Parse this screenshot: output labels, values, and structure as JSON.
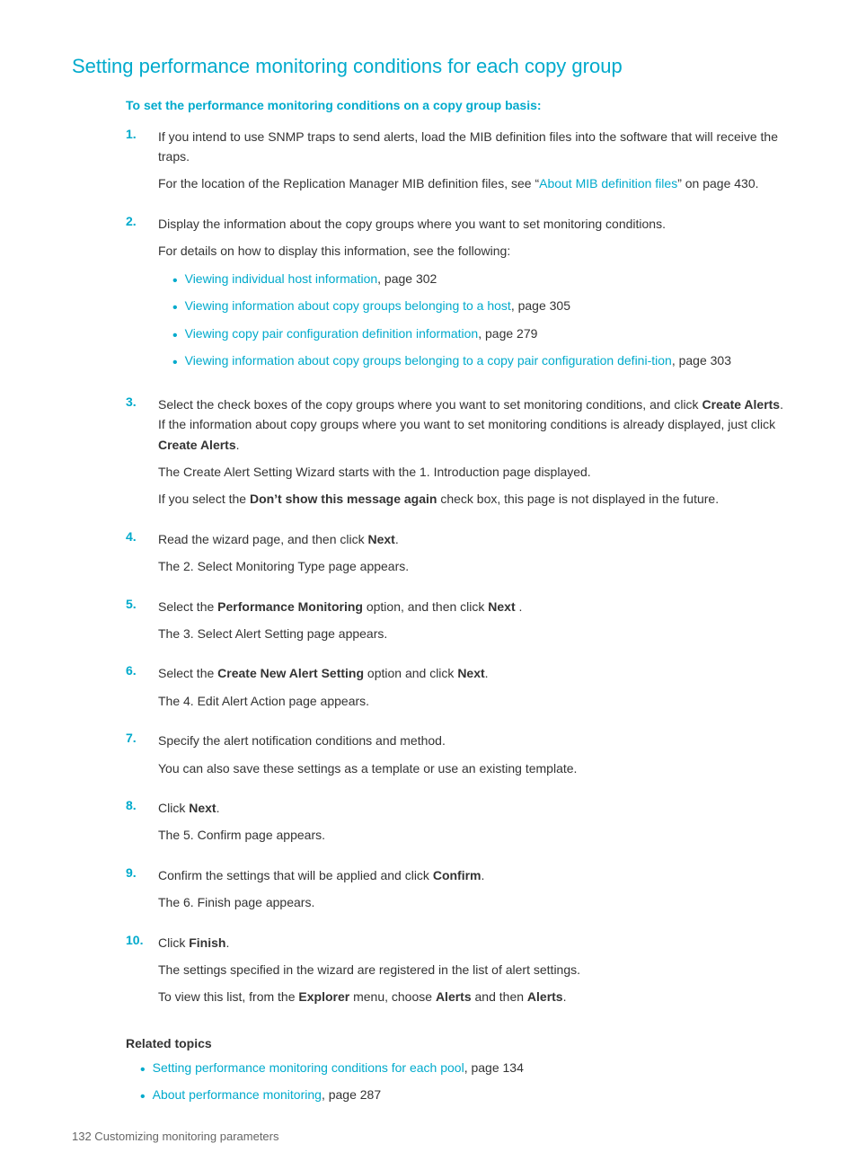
{
  "page": {
    "title": "Setting performance monitoring conditions for each copy group",
    "subtitle": "To set the performance monitoring conditions on a copy group basis:",
    "steps": [
      {
        "number": "1.",
        "text": "If you intend to use SNMP traps to send alerts,  load the MIB definition files into the software that will receive the traps.",
        "sub": "For the location of the Replication Manager MIB definition files, see “",
        "link1": "About MIB definition files",
        "link1_after": "” on page 430.",
        "has_sub": true
      },
      {
        "number": "2.",
        "text": "Display the information about the copy groups where you want to set monitoring conditions.",
        "sub": "For details on how to display this information, see the following:",
        "has_bullets": true
      },
      {
        "number": "3.",
        "text_parts": [
          "Select the check boxes of the copy groups where you want to set monitoring conditions, and click ",
          "Create Alerts",
          ". If the information about copy groups where you want to set monitoring conditions is already displayed, just click ",
          "Create Alerts",
          "."
        ],
        "sub1": "The Create Alert Setting Wizard starts with the 1. Introduction page displayed.",
        "sub2_parts": [
          "If you select the ",
          "Don’t show this message again",
          " check box, this page is not displayed in the future."
        ],
        "has_sub2": true
      },
      {
        "number": "4.",
        "text_parts": [
          "Read the wizard page, and then click ",
          "Next",
          "."
        ],
        "sub": "The 2. Select Monitoring Type page appears."
      },
      {
        "number": "5.",
        "text_parts": [
          "Select the ",
          "Performance Monitoring",
          " option, and then click ",
          "Next",
          " ."
        ],
        "sub": "The 3. Select Alert Setting page appears."
      },
      {
        "number": "6.",
        "text_parts": [
          "Select the ",
          "Create New Alert Setting",
          " option and click ",
          "Next",
          "."
        ],
        "sub": "The 4. Edit Alert Action page appears."
      },
      {
        "number": "7.",
        "text": "Specify the alert notification conditions and method.",
        "sub": "You can also save these settings as a template or use an existing template."
      },
      {
        "number": "8.",
        "text_parts": [
          "Click ",
          "Next",
          "."
        ],
        "sub": "The 5. Confirm page appears."
      },
      {
        "number": "9.",
        "text_parts": [
          "Confirm the settings that will be applied and click ",
          "Confirm",
          "."
        ],
        "sub": "The 6. Finish page appears."
      },
      {
        "number": "10.",
        "text_parts": [
          "Click ",
          "Finish",
          "."
        ],
        "sub1": "The settings specified in the wizard are registered in the list of alert settings.",
        "sub2_parts": [
          "To view this list, from the ",
          "Explorer",
          " menu, choose ",
          "Alerts",
          " and then ",
          "Alerts",
          "."
        ],
        "is_10": true
      }
    ],
    "bullets": [
      {
        "link": "Viewing individual host information",
        "page": ", page 302"
      },
      {
        "link": "Viewing information about copy groups belonging to a host",
        "page": ", page 305"
      },
      {
        "link": "Viewing copy pair configuration definition information",
        "page": ", page 279"
      },
      {
        "link": "Viewing information about copy groups belonging to a copy pair configuration defini-tion",
        "page": ", page 303"
      }
    ],
    "related_topics": {
      "title": "Related topics",
      "items": [
        {
          "link": "Setting performance monitoring conditions for each pool",
          "page": ", page 134"
        },
        {
          "link": "About performance monitoring",
          "page": ", page 287"
        }
      ]
    },
    "footer": "132     Customizing monitoring parameters"
  }
}
